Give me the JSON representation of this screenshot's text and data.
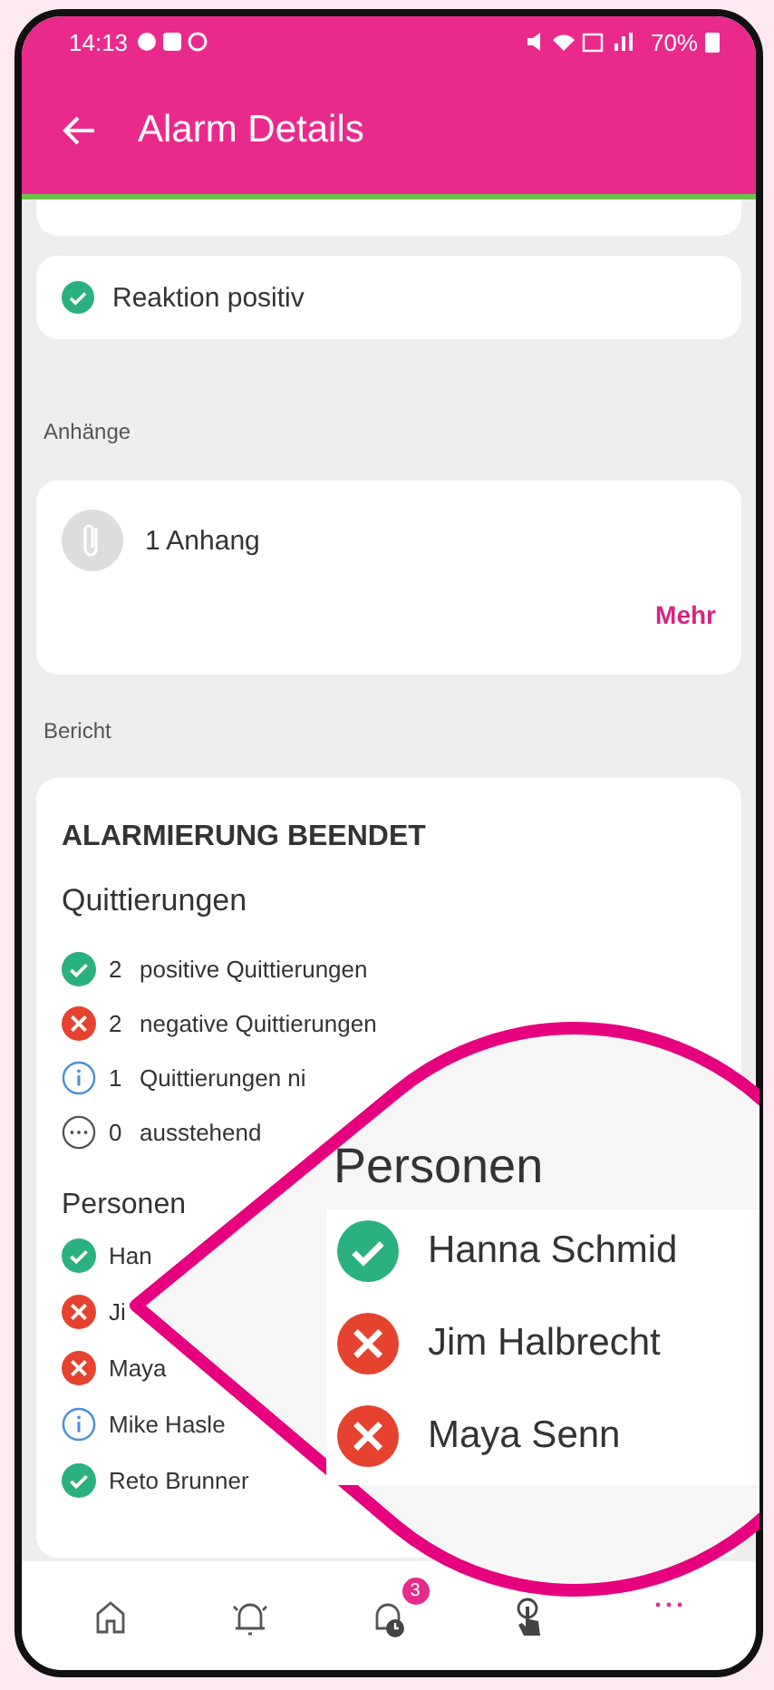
{
  "status_bar": {
    "time": "14:13",
    "battery": "70%"
  },
  "app_bar": {
    "title": "Alarm Details"
  },
  "reaction": {
    "kind": "positive",
    "label": "Reaktion positiv"
  },
  "attachments": {
    "section_label": "Anhänge",
    "count_label": "1 Anhang",
    "more_link": "Mehr"
  },
  "report": {
    "section_label": "Bericht",
    "title": "ALARMIERUNG BEENDET",
    "acknowledgements_heading": "Quittierungen",
    "acknowledgements": [
      {
        "kind": "positive",
        "count": "2",
        "label": "positive Quittierungen"
      },
      {
        "kind": "negative",
        "count": "2",
        "label": "negative Quittierungen"
      },
      {
        "kind": "info",
        "count": "1",
        "label": "Quittierungen ni"
      },
      {
        "kind": "pending",
        "count": "0",
        "label": "ausstehend"
      }
    ],
    "persons_heading": "Personen",
    "persons": [
      {
        "kind": "positive",
        "name": "Han"
      },
      {
        "kind": "negative",
        "name": "Ji"
      },
      {
        "kind": "negative",
        "name": "Maya"
      },
      {
        "kind": "info",
        "name": "Mike Hasle"
      },
      {
        "kind": "positive",
        "name": "Reto Brunner"
      }
    ]
  },
  "magnifier": {
    "heading": "Personen",
    "persons": [
      {
        "kind": "positive",
        "name": "Hanna Schmid"
      },
      {
        "kind": "negative",
        "name": "Jim Halbrecht"
      },
      {
        "kind": "negative",
        "name": "Maya Senn"
      }
    ]
  },
  "bottom_nav": {
    "items": [
      {
        "kind": "home"
      },
      {
        "kind": "alarm"
      },
      {
        "kind": "alarm-history",
        "badge": "3"
      },
      {
        "kind": "touch"
      },
      {
        "kind": "more"
      }
    ]
  }
}
